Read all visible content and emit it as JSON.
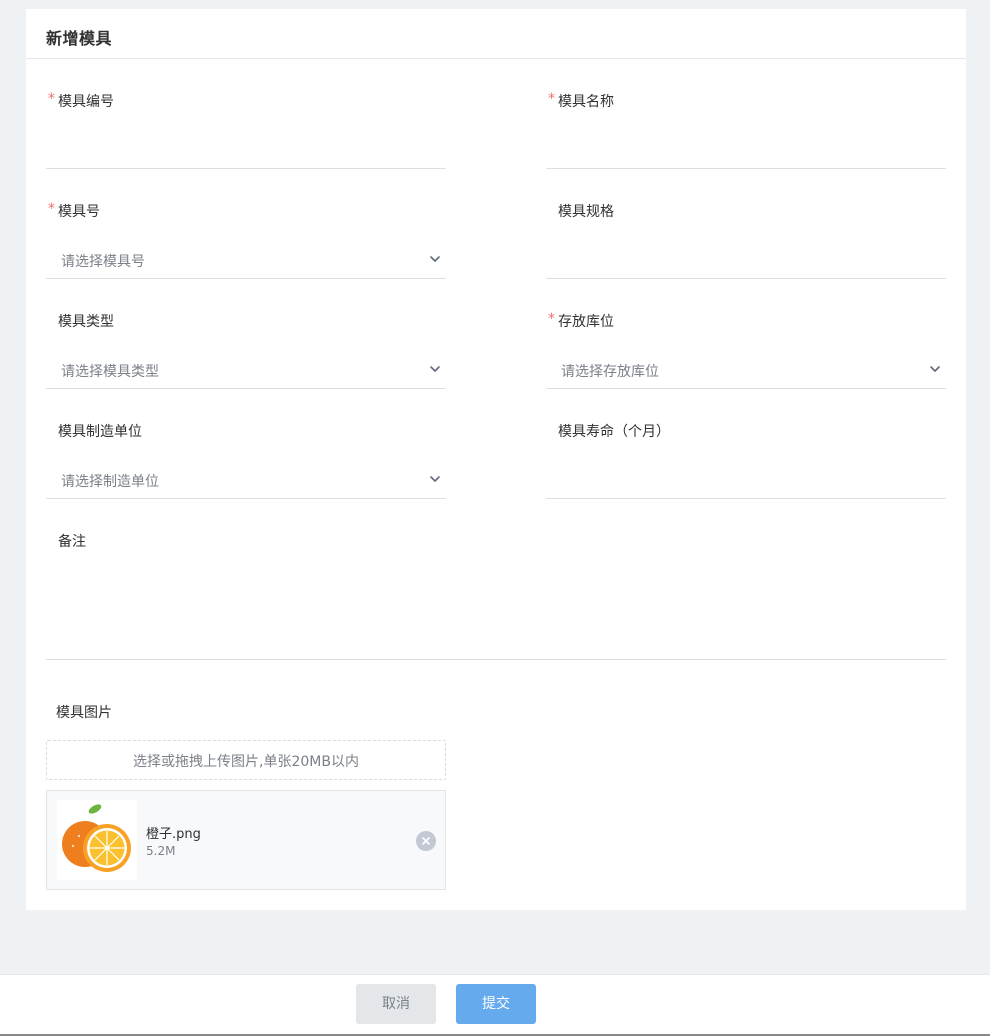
{
  "form": {
    "title": "新增模具",
    "required_mark": "*",
    "fields": {
      "mold_code": {
        "label": "模具编号",
        "required": true,
        "value": ""
      },
      "mold_name": {
        "label": "模具名称",
        "required": true,
        "value": ""
      },
      "mold_number": {
        "label": "模具号",
        "required": true,
        "placeholder": "请选择模具号"
      },
      "mold_spec": {
        "label": "模具规格",
        "required": false,
        "value": ""
      },
      "mold_type": {
        "label": "模具类型",
        "required": false,
        "placeholder": "请选择模具类型"
      },
      "storage_location": {
        "label": "存放库位",
        "required": true,
        "placeholder": "请选择存放库位"
      },
      "manufacturer": {
        "label": "模具制造单位",
        "required": false,
        "placeholder": "请选择制造单位"
      },
      "lifespan": {
        "label": "模具寿命（个月）",
        "required": false,
        "value": ""
      },
      "remark": {
        "label": "备注",
        "value": ""
      }
    },
    "upload": {
      "label": "模具图片",
      "dropzone_text": "选择或拖拽上传图片,单张20MB以内",
      "files": [
        {
          "name": "橙子.png",
          "size": "5.2M"
        }
      ]
    }
  },
  "footer": {
    "cancel_label": "取消",
    "submit_label": "提交"
  },
  "icons": {
    "select_chevron": "chevron-down-icon",
    "remove_file": "close-circle-icon",
    "thumbnail": "orange-image"
  },
  "colors": {
    "required": "#f56c6c",
    "primary_button": "#66aaee",
    "cancel_button": "#e4e7ea",
    "page_background": "#eff2f4"
  }
}
